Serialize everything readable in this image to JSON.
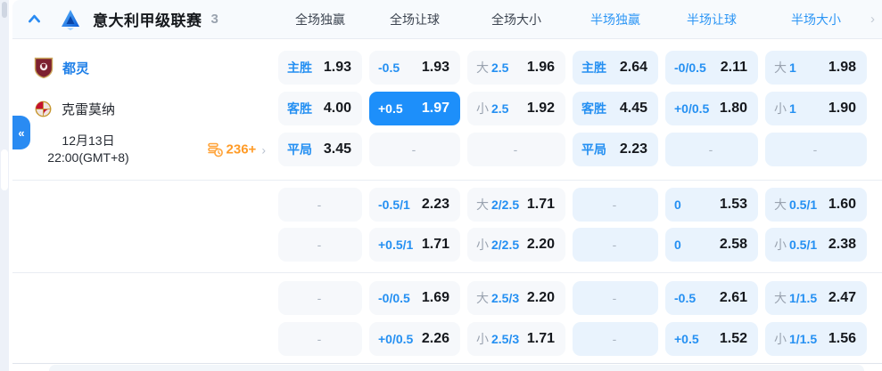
{
  "header": {
    "league_name": "意大利甲级联赛",
    "match_count": "3",
    "columns": [
      {
        "label": "全场独赢",
        "half": false
      },
      {
        "label": "全场让球",
        "half": false
      },
      {
        "label": "全场大小",
        "half": false
      },
      {
        "label": "半场独赢",
        "half": true
      },
      {
        "label": "半场让球",
        "half": true
      },
      {
        "label": "半场大小",
        "half": true
      }
    ],
    "more_icon": "›",
    "collapse_icon": "^"
  },
  "match": {
    "home_team": "都灵",
    "away_team": "克雷莫纳",
    "date_line1": "12月13日",
    "date_line2": "22:00(GMT+8)",
    "extra_markets": "236+",
    "extra_arrow": "›",
    "collapse_sidebar_icon": "«"
  },
  "odds_rows": [
    {
      "cells": [
        {
          "label": "主胜",
          "value": "1.93"
        },
        {
          "label": "-0.5",
          "value": "1.93"
        },
        {
          "prefix": "大",
          "label": "2.5",
          "value": "1.96"
        },
        {
          "label": "主胜",
          "value": "2.64"
        },
        {
          "label": "-0/0.5",
          "value": "2.11"
        },
        {
          "prefix": "大",
          "label": "1",
          "value": "1.98"
        }
      ]
    },
    {
      "cells": [
        {
          "label": "客胜",
          "value": "4.00"
        },
        {
          "label": "+0.5",
          "value": "1.97",
          "selected": true
        },
        {
          "prefix": "小",
          "label": "2.5",
          "value": "1.92"
        },
        {
          "label": "客胜",
          "value": "4.45"
        },
        {
          "label": "+0/0.5",
          "value": "1.80"
        },
        {
          "prefix": "小",
          "label": "1",
          "value": "1.90"
        }
      ]
    },
    {
      "cells": [
        {
          "label": "平局",
          "value": "3.45"
        },
        {
          "dash": true
        },
        {
          "dash": true
        },
        {
          "label": "平局",
          "value": "2.23"
        },
        {
          "dash": true
        },
        {
          "dash": true
        }
      ]
    },
    {
      "cells": [
        {
          "dash": true
        },
        {
          "label": "-0.5/1",
          "value": "2.23"
        },
        {
          "prefix": "大",
          "label": "2/2.5",
          "value": "1.71"
        },
        {
          "dash": true
        },
        {
          "label": "0",
          "value": "1.53"
        },
        {
          "prefix": "大",
          "label": "0.5/1",
          "value": "1.60"
        }
      ]
    },
    {
      "cells": [
        {
          "dash": true
        },
        {
          "label": "+0.5/1",
          "value": "1.71"
        },
        {
          "prefix": "小",
          "label": "2/2.5",
          "value": "2.20"
        },
        {
          "dash": true
        },
        {
          "label": "0",
          "value": "2.58"
        },
        {
          "prefix": "小",
          "label": "0.5/1",
          "value": "2.38"
        }
      ]
    },
    {
      "cells": [
        {
          "dash": true
        },
        {
          "label": "-0/0.5",
          "value": "1.69"
        },
        {
          "prefix": "大",
          "label": "2.5/3",
          "value": "2.20"
        },
        {
          "dash": true
        },
        {
          "label": "-0.5",
          "value": "2.61"
        },
        {
          "prefix": "大",
          "label": "1/1.5",
          "value": "2.47"
        }
      ]
    },
    {
      "cells": [
        {
          "dash": true
        },
        {
          "label": "+0/0.5",
          "value": "2.26"
        },
        {
          "prefix": "小",
          "label": "2.5/3",
          "value": "1.71"
        },
        {
          "dash": true
        },
        {
          "label": "+0.5",
          "value": "1.52"
        },
        {
          "prefix": "小",
          "label": "1/1.5",
          "value": "1.56"
        }
      ]
    }
  ],
  "dash_char": "-",
  "colors": {
    "accent_blue": "#2590f2",
    "selected_blue": "#1d8ffa",
    "half_header_blue": "#2b95f5",
    "full_cell_bg": "#f6f8fb",
    "half_cell_bg": "#e9f3fd",
    "orange": "#ff9b27",
    "home_team_blue": "#2080e8"
  },
  "icons": {
    "collapse_header": "chevron-up",
    "collapse_sidebar": "double-chevron-left",
    "league_logo": "serie-a-logo",
    "home_logo": "torino-crest",
    "away_logo": "cremonese-crest",
    "live_count": "coins-clock",
    "more": "chevron-right"
  }
}
